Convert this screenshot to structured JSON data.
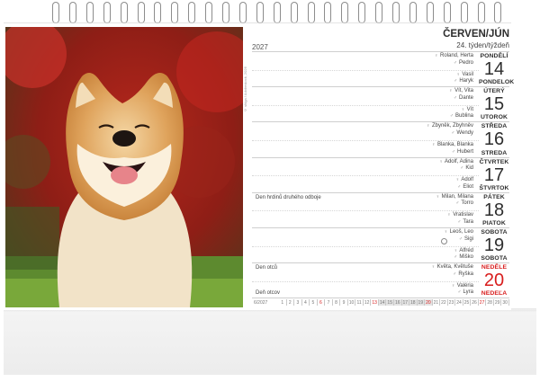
{
  "header": {
    "year": "2027",
    "month": "ČERVEN/JÚN",
    "week": "24. týden/týždeň"
  },
  "photo_credit": "© shiga / Adobestock, 2026",
  "days": [
    {
      "name_cz": "PONDĚLÍ",
      "num": "14",
      "name_sk": "PONDELOK",
      "names": [
        "Roland, Herta",
        "Pedro",
        "Vasil",
        "Haryk"
      ],
      "moon": false,
      "sunday": false
    },
    {
      "name_cz": "ÚTERÝ",
      "num": "15",
      "name_sk": "UTOROK",
      "names": [
        "Vít, Vita",
        "Dante",
        "Vít",
        "Bublina"
      ],
      "moon": false,
      "sunday": false
    },
    {
      "name_cz": "STŘEDA",
      "num": "16",
      "name_sk": "STREDA",
      "names": [
        "Zbyněk, Zbyhněv",
        "Wendy",
        "Blanka, Blanka",
        "Hubert"
      ],
      "moon": false,
      "sunday": false
    },
    {
      "name_cz": "ČTVRTEK",
      "num": "17",
      "name_sk": "ŠTVRTOK",
      "names": [
        "Adolf, Adina",
        "Kid",
        "Adolf",
        "Eliot"
      ],
      "moon": false,
      "sunday": false
    },
    {
      "name_cz": "PÁTEK",
      "num": "18",
      "name_sk": "PIATOK",
      "names": [
        "Milan, Milana",
        "Torro",
        "Vratislav",
        "Tara"
      ],
      "event_top": "Den hrdinů druhého odboje",
      "moon": false,
      "sunday": false
    },
    {
      "name_cz": "SOBOTA",
      "num": "19",
      "name_sk": "SOBOTA",
      "names": [
        "Leoš, Leo",
        "Sigi",
        "Alfréd",
        "Miško"
      ],
      "moon": true,
      "sunday": false
    },
    {
      "name_cz": "NEDĚLE",
      "num": "20",
      "name_sk": "NEDEĽA",
      "names": [
        "Květa, Květuše",
        "Ryška",
        "Valéria",
        "Lyra"
      ],
      "event_top": "Den otců",
      "event_bottom": "Deň otcov",
      "moon": false,
      "sunday": true
    }
  ],
  "mini_calendar": {
    "label": "6/2027",
    "days": [
      "1",
      "2",
      "3",
      "4",
      "5",
      "6",
      "7",
      "8",
      "9",
      "10",
      "11",
      "12",
      "13",
      "14",
      "15",
      "16",
      "17",
      "18",
      "19",
      "20",
      "21",
      "22",
      "23",
      "24",
      "25",
      "26",
      "27",
      "28",
      "29",
      "30"
    ],
    "sundays": [
      "6",
      "13",
      "20",
      "27"
    ],
    "highlight_week": [
      "14",
      "15",
      "16",
      "17",
      "18",
      "19",
      "20"
    ]
  },
  "colors": {
    "sunday": "#d81d1d",
    "text": "#2e2e2e"
  },
  "icons": [
    "female-sign-icon",
    "male-sign-icon",
    "full-moon-icon"
  ]
}
